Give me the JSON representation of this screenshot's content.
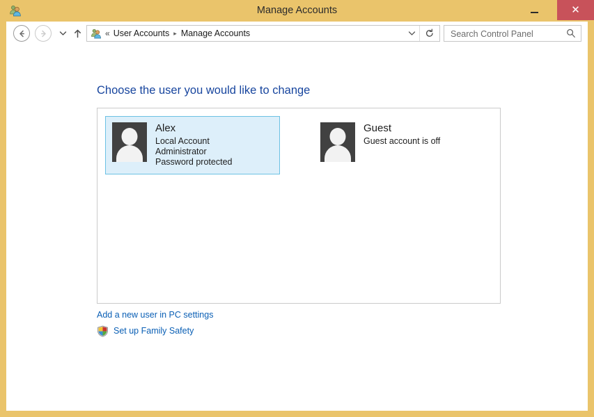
{
  "window": {
    "title": "Manage Accounts",
    "icon": "user-accounts-icon",
    "frame_color": "#eac46b",
    "controls": {
      "minimize_label": "",
      "maximize_label": "",
      "close_label": "✕"
    }
  },
  "navbar": {
    "back_icon": "back-arrow-icon",
    "forward_icon": "forward-arrow-icon",
    "recent_icon": "chevron-down-icon",
    "up_icon": "up-arrow-icon",
    "address_icon": "user-accounts-icon",
    "breadcrumb_prefix": "«",
    "breadcrumbs": [
      {
        "label": "User Accounts"
      },
      {
        "label": "Manage Accounts"
      }
    ],
    "breadcrumb_separator": "▸",
    "dropdown_icon": "chevron-down-icon",
    "refresh_icon": "refresh-icon"
  },
  "search": {
    "placeholder": "Search Control Panel",
    "value": "",
    "icon": "search-icon"
  },
  "main": {
    "heading": "Choose the user you would like to change",
    "heading_color": "#17459e",
    "accounts": [
      {
        "name": "Alex",
        "lines": [
          "Local Account",
          "Administrator",
          "Password protected"
        ],
        "selected": true,
        "avatar_icon": "user-avatar-icon"
      },
      {
        "name": "Guest",
        "lines": [
          "Guest account is off"
        ],
        "selected": false,
        "avatar_icon": "user-avatar-icon"
      }
    ],
    "links": [
      {
        "label": "Add a new user in PC settings",
        "icon": null
      },
      {
        "label": "Set up Family Safety",
        "icon": "shield-icon"
      }
    ],
    "link_color": "#0a5fb5"
  }
}
